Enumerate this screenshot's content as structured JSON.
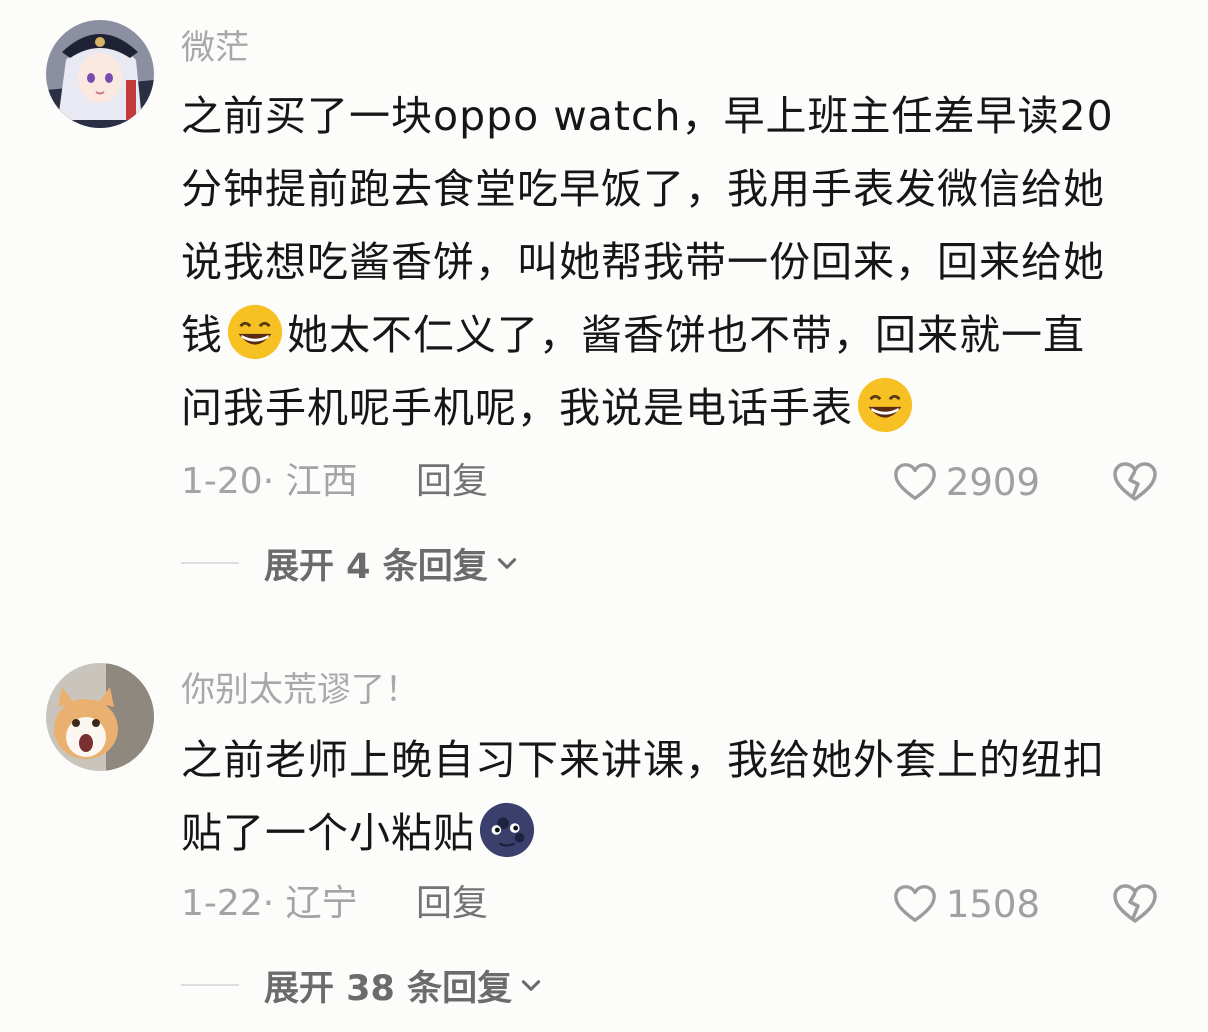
{
  "comments": [
    {
      "username": "微茫",
      "avatar_icon": "anime-girl-avatar",
      "lines": [
        [
          "之前买了一块oppo watch，早上班主任差早读20"
        ],
        [
          "分钟提前跑去食堂吃早饭了，我用手表发微信给她"
        ],
        [
          "说我想吃酱香饼，叫她帮我带一份回来，回来给她"
        ],
        [
          "钱",
          "她太不仁义了，酱香饼也不带，回来就一直"
        ],
        [
          "问我手机呢手机呢，我说是电话手表",
          ""
        ]
      ],
      "emoji_icon": "grinning-squint-emoji",
      "meta": "1-20· 江西",
      "reply_label": "回复",
      "like_count": "2909",
      "expand_label": "展开 4 条回复"
    },
    {
      "username": "你别太荒谬了！",
      "avatar_icon": "cat-avatar",
      "lines": [
        [
          "之前老师上晚自习下来讲课，我给她外套上的纽扣"
        ],
        [
          "贴了一个小粘贴",
          ""
        ]
      ],
      "emoji_icon": "new-moon-face-emoji",
      "meta": "1-22· 辽宁",
      "reply_label": "回复",
      "like_count": "1508",
      "expand_label": "展开 38 条回复"
    }
  ],
  "colors": {
    "background": "#fcfcfa",
    "text": "#161616",
    "muted": "#a4a4a4",
    "emoji_yellow": "#f7c023",
    "moon": "#3b3f6b"
  }
}
